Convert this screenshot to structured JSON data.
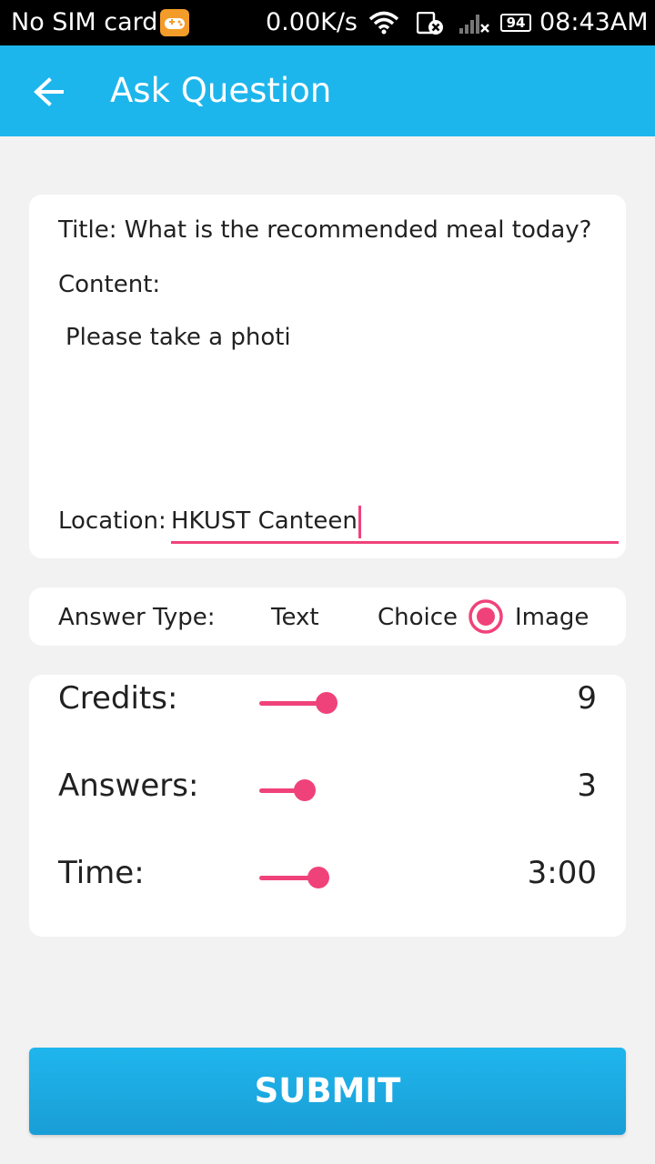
{
  "status_bar": {
    "carrier": "No SIM card",
    "speed": "0.00K/s",
    "battery": "94",
    "time": "08:43AM",
    "icons": [
      "game-icon",
      "wifi-icon",
      "sim-icon",
      "signal-icon",
      "battery-icon"
    ]
  },
  "app_bar": {
    "title": "Ask Question",
    "back_icon": "arrow-back-icon",
    "color": "#1db6ec"
  },
  "question": {
    "title_line": "Title: What is the recommended meal today?",
    "content_label": "Content:",
    "content_value": "Please take a photi",
    "location_label": "Location:",
    "location_value": "HKUST Canteen"
  },
  "answer_type": {
    "label": "Answer Type:",
    "options": [
      "Text",
      "Choice",
      "Image"
    ],
    "selected": "Image"
  },
  "params": {
    "credits": {
      "label": "Credits:",
      "value": "9",
      "level": 0.65
    },
    "answers": {
      "label": "Answers:",
      "value": "3",
      "level": 0.4
    },
    "time": {
      "label": "Time:",
      "value": "3:00",
      "level": 0.55
    }
  },
  "submit_label": "SUBMIT",
  "colors": {
    "accent": "#f0427a",
    "primary": "#1db6ec",
    "background": "#f2f2f2"
  }
}
